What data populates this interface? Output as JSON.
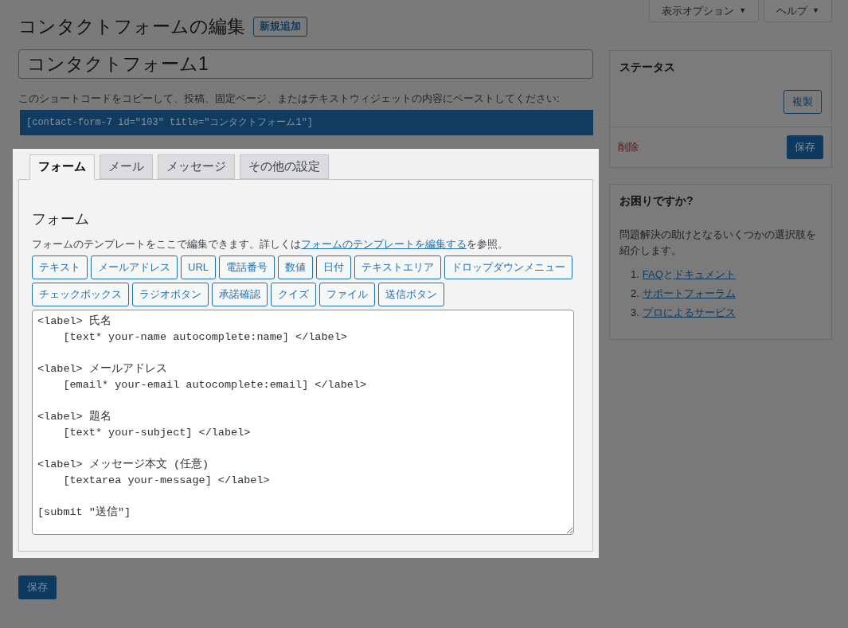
{
  "header": {
    "title": "コンタクトフォームの編集",
    "add_new": "新規追加"
  },
  "screen_options": [
    {
      "label": "表示オプション",
      "caret": "▼"
    },
    {
      "label": "ヘルプ",
      "caret": "▼"
    }
  ],
  "form_title": {
    "value": "コンタクトフォーム1"
  },
  "shortcode": {
    "hint": "このショートコードをコピーして、投稿、固定ページ、またはテキストウィジェットの内容にペーストしてください:",
    "code": "[contact-form-7 id=\"103\" title=\"コンタクトフォーム1\"]"
  },
  "tabs": [
    {
      "label": "フォーム",
      "selected": true
    },
    {
      "label": "メール",
      "selected": false
    },
    {
      "label": "メッセージ",
      "selected": false
    },
    {
      "label": "その他の設定",
      "selected": false
    }
  ],
  "panel": {
    "heading": "フォーム",
    "desc_before": "フォームのテンプレートをここで編集できます。詳しくは",
    "desc_link": "フォームのテンプレートを編集する",
    "desc_after": "を参照。",
    "tag_buttons": [
      [
        "テキスト",
        "メールアドレス",
        "URL",
        "電話番号",
        "数値",
        "日付",
        "テキストエリア",
        "ドロップダウンメニュー"
      ],
      [
        "チェックボックス",
        "ラジオボタン",
        "承諾確認",
        "クイズ",
        "ファイル",
        "送信ボタン"
      ]
    ],
    "template": "<label> 氏名\n    [text* your-name autocomplete:name] </label>\n\n<label> メールアドレス\n    [email* your-email autocomplete:email] </label>\n\n<label> 題名\n    [text* your-subject] </label>\n\n<label> メッセージ本文 (任意)\n    [textarea your-message] </label>\n\n[submit \"送信\"]"
  },
  "save_button": "保存",
  "status_box": {
    "title": "ステータス",
    "duplicate": "複製",
    "delete": "削除",
    "save": "保存"
  },
  "help_box": {
    "title": "お困りですか?",
    "text": "問題解決の助けとなるいくつかの選択肢を紹介します。",
    "links": [
      {
        "number": "1.",
        "parts": [
          "FAQ",
          "と",
          "ドキュメント"
        ]
      },
      {
        "number": "2.",
        "parts": [
          "サポートフォーラム"
        ]
      },
      {
        "number": "3.",
        "parts": [
          "プロによるサービス"
        ]
      }
    ]
  }
}
